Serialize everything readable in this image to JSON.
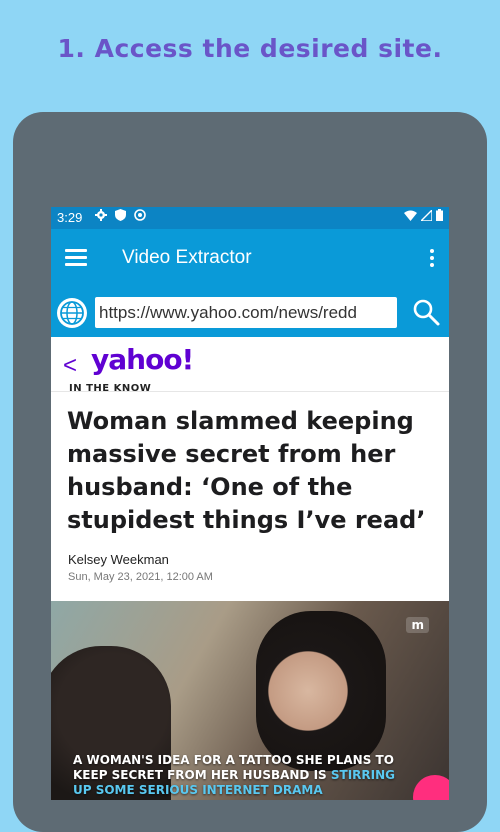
{
  "promo": {
    "headline": "1. Access the desired site."
  },
  "status_bar": {
    "time": "3:29"
  },
  "app_bar": {
    "title": "Video Extractor"
  },
  "url_bar": {
    "value": "https://www.yahoo.com/news/redd"
  },
  "site": {
    "back": "<",
    "logo": "yahoo!"
  },
  "article": {
    "kicker": "IN THE KNOW",
    "title": "Woman slammed keeping massive secret from her husband: ‘One of the stupidest things I’ve read’",
    "author": "Kelsey Weekman",
    "date": "Sun, May 23, 2021, 12:00 AM",
    "image_tag": "m",
    "caption_normal": "A WOMAN'S IDEA FOR A TATTOO SHE PLANS TO KEEP SECRET FROM HER HUSBAND IS ",
    "caption_highlight": "STIRRING UP SOME SERIOUS INTERNET DRAMA"
  },
  "colors": {
    "background": "#8fd6f5",
    "headline": "#6a55c8",
    "device": "#5e6b74",
    "app_bar": "#0a9ad8",
    "status_bar": "#0c84c4",
    "yahoo_purple": "#6001d2"
  },
  "icons": [
    "settings-icon",
    "shield-icon",
    "sync-icon",
    "wifi-icon",
    "signal-icon",
    "battery-icon",
    "hamburger-menu-icon",
    "more-vert-icon",
    "globe-icon",
    "search-icon",
    "back-chevron-icon"
  ]
}
